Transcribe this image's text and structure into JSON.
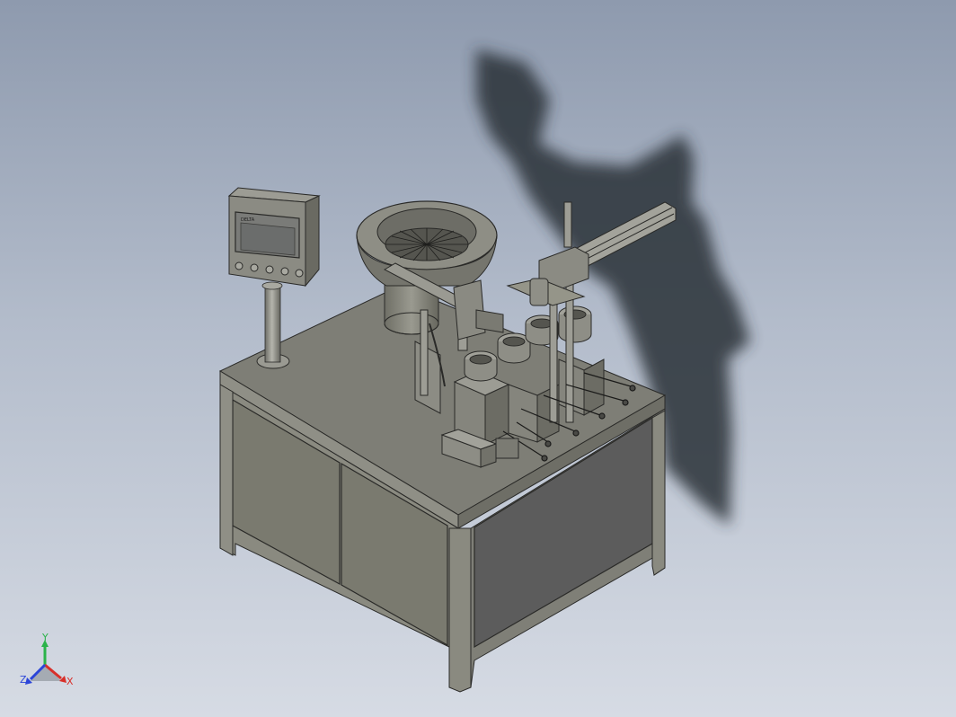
{
  "viewport": {
    "background_top": "#8e9aae",
    "background_bottom": "#d6dbe4"
  },
  "model": {
    "hmi_brand": "DELTA",
    "hmi_icon": "touch-screen-panel-icon",
    "colors": {
      "frame": "#8a8a80",
      "panel_left": "#7b7b70",
      "panel_right": "#5a5a5a",
      "tabletop": "#7e7e76",
      "shadow": "#2c3138"
    }
  },
  "triad": {
    "x_label": "X",
    "y_label": "Y",
    "z_label": "Z",
    "x_color": "#d8302a",
    "y_color": "#2bb34a",
    "z_color": "#2b45d8"
  }
}
